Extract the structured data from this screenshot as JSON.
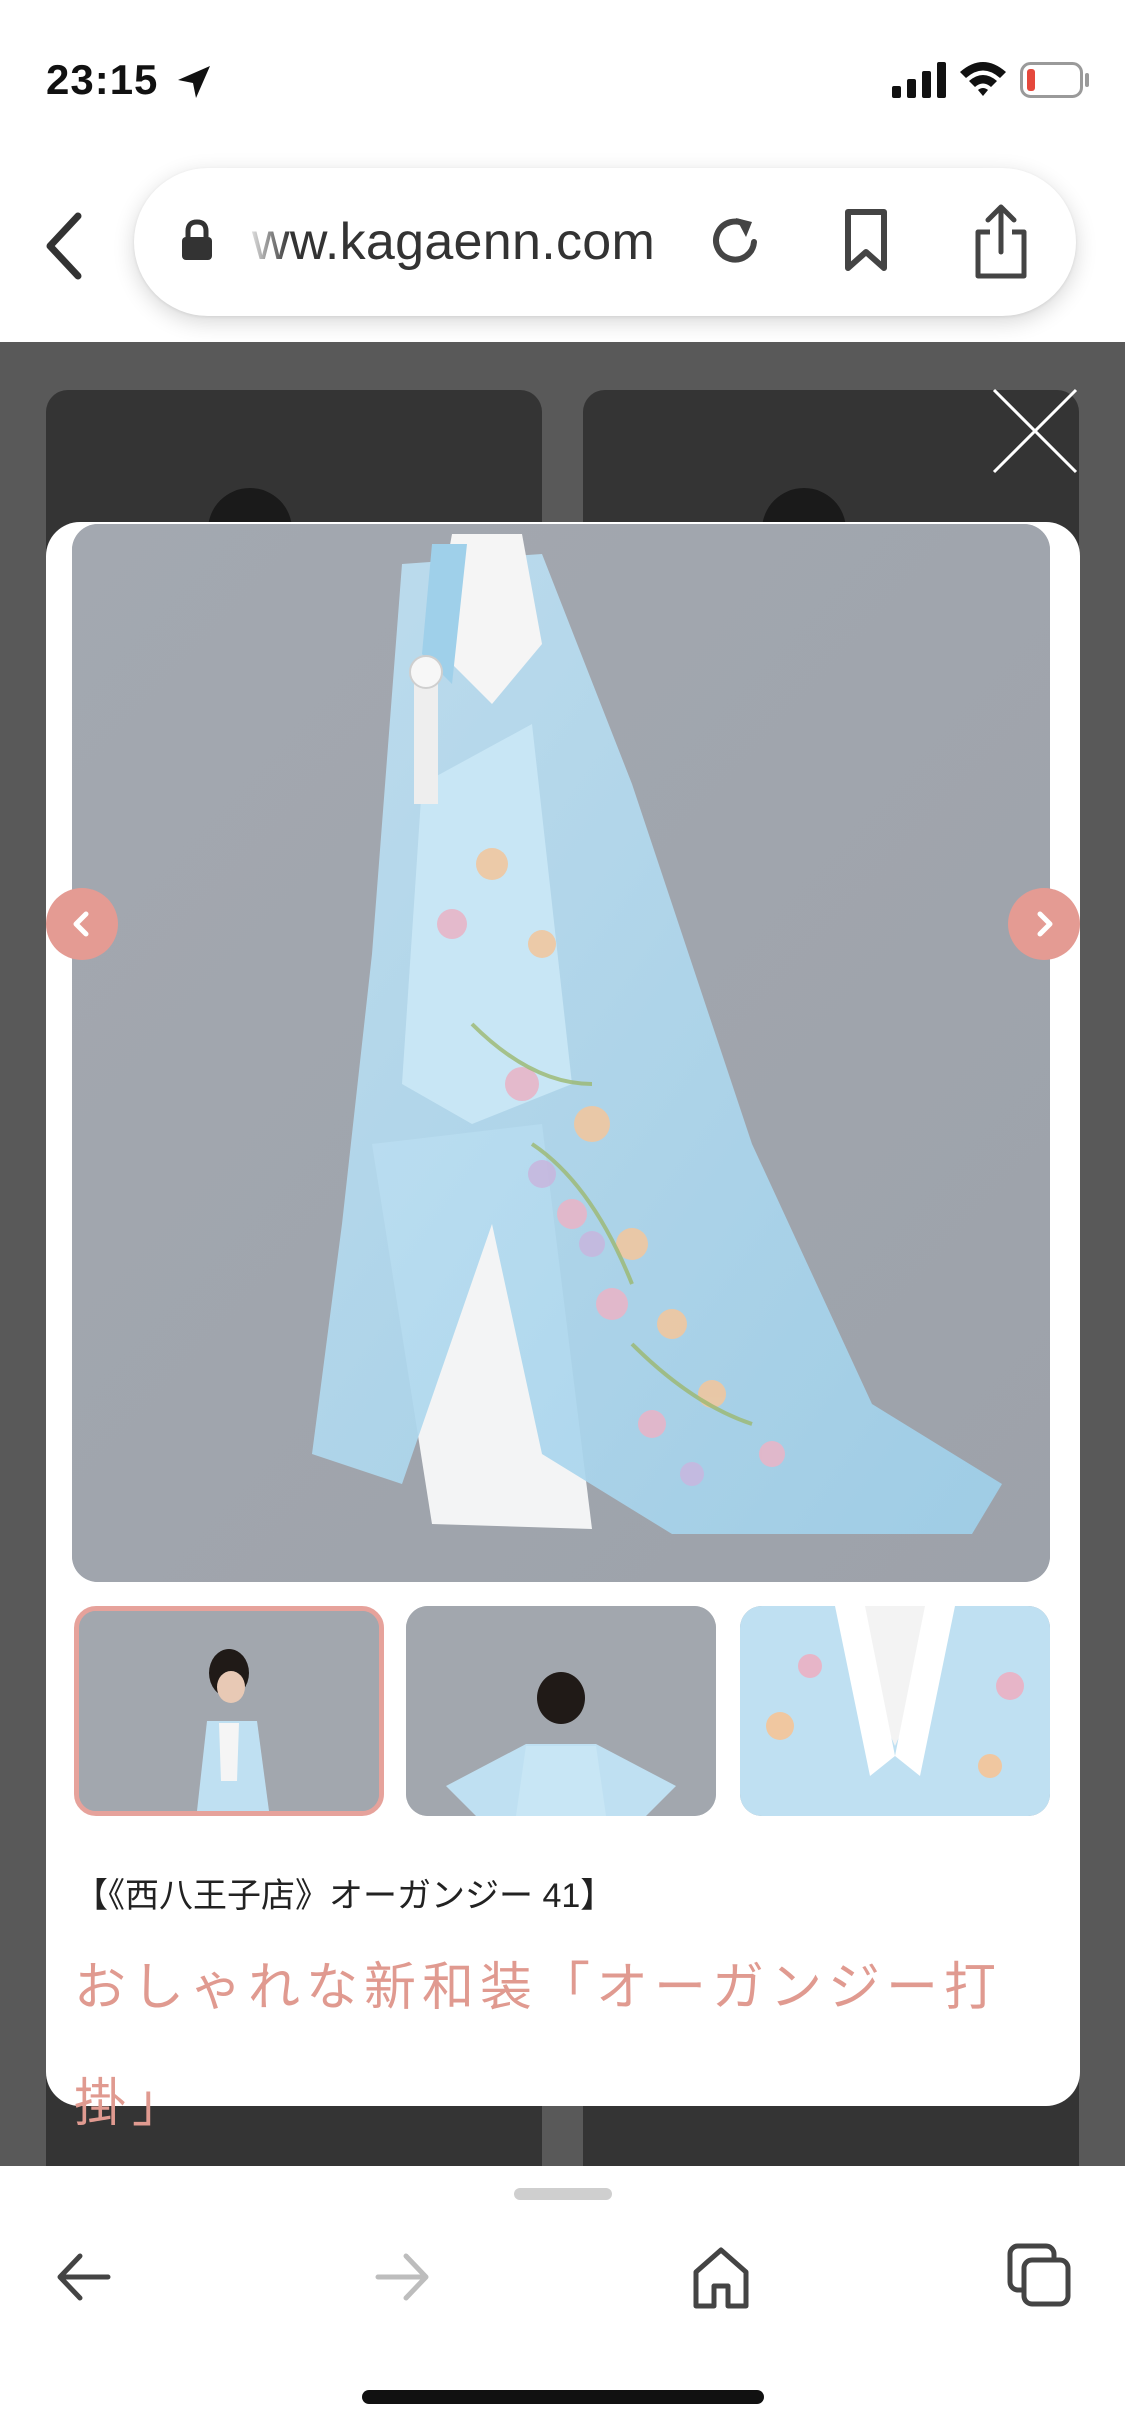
{
  "status_bar": {
    "time": "23:15",
    "icons": [
      "location-arrow-icon",
      "cellular-signal-icon",
      "wifi-icon",
      "battery-low-icon"
    ],
    "battery_color": "#e5483c"
  },
  "browser": {
    "url": "ww.kagaenn.com",
    "icons": [
      "back-chevron-icon",
      "lock-icon",
      "reload-icon",
      "bookmark-icon",
      "share-icon"
    ]
  },
  "modal": {
    "close_icon": "close-x-icon",
    "caption": "【《西八王子店》オーガンジー 41】",
    "headline_line1": "おしゃれな新和装「オーガンジー打",
    "headline_line2": "掛」",
    "accent_color": "#e09a90",
    "thumbnails": [
      {
        "label": "side-view",
        "selected": true
      },
      {
        "label": "back-view",
        "selected": false
      },
      {
        "label": "collar-closeup",
        "selected": false
      }
    ],
    "nav_icons": [
      "chevron-left-icon",
      "chevron-right-icon"
    ]
  },
  "toolbar": {
    "icons": [
      "back-arrow-icon",
      "forward-arrow-icon",
      "home-icon",
      "tabs-icon"
    ]
  }
}
